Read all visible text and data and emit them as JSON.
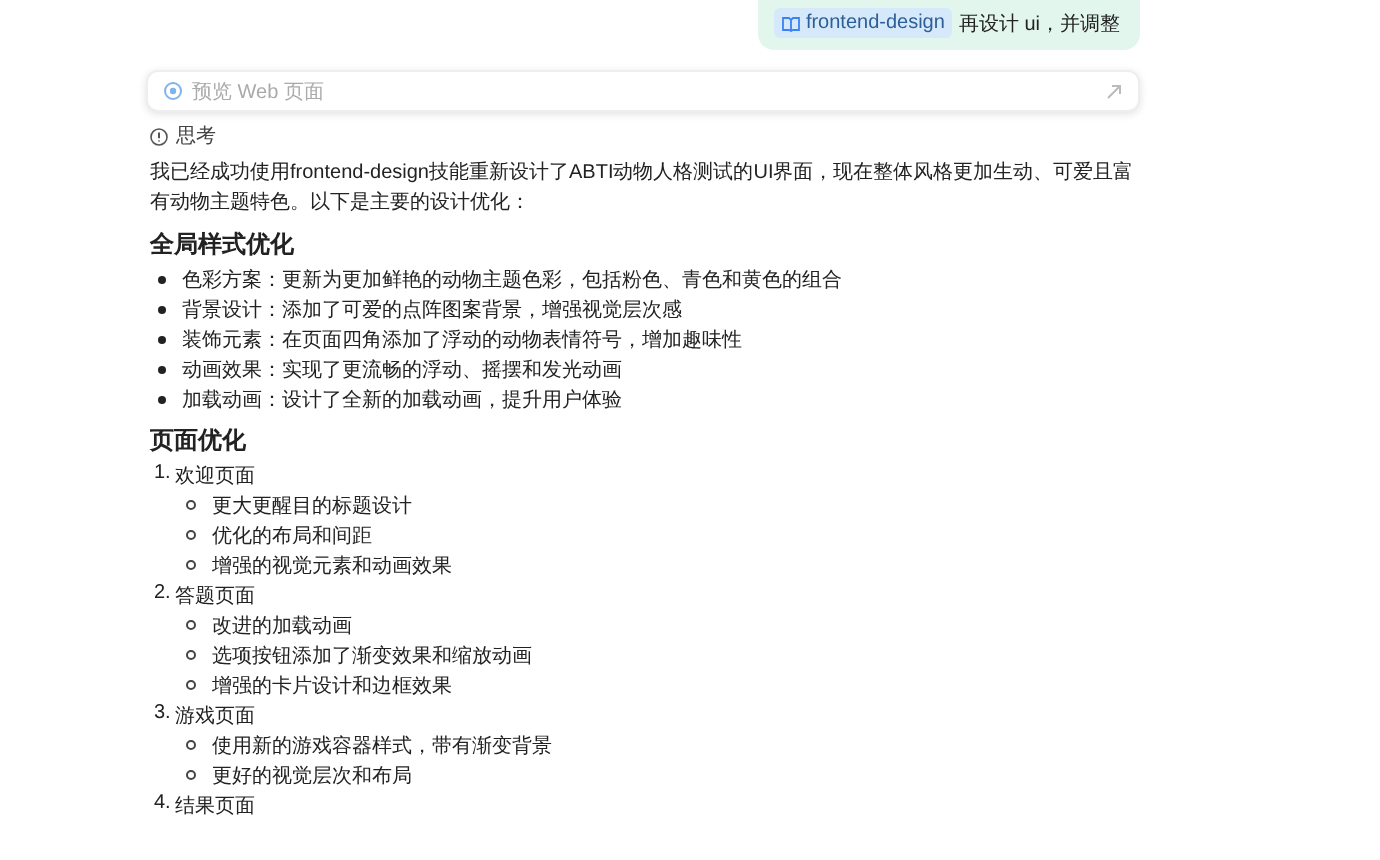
{
  "user_message": {
    "skill_tag": "frontend-design",
    "text": "再设计 ui，并调整"
  },
  "web_preview": {
    "label": "预览 Web 页面"
  },
  "thinking": {
    "label": "思考"
  },
  "response": {
    "intro": "我已经成功使用frontend-design技能重新设计了ABTI动物人格测试的UI界面，现在整体风格更加生动、可爱且富有动物主题特色。以下是主要的设计优化：",
    "sections": [
      {
        "heading": "全局样式优化",
        "kind": "bullets",
        "items": [
          {
            "text": "色彩方案：更新为更加鲜艳的动物主题色彩，包括粉色、青色和黄色的组合"
          },
          {
            "text": "背景设计：添加了可爱的点阵图案背景，增强视觉层次感"
          },
          {
            "text": "装饰元素：在页面四角添加了浮动的动物表情符号，增加趣味性"
          },
          {
            "text": "动画效果：实现了更流畅的浮动、摇摆和发光动画"
          },
          {
            "text": "加载动画：设计了全新的加载动画，提升用户体验"
          }
        ]
      },
      {
        "heading": "页面优化",
        "kind": "numbered",
        "items": [
          {
            "number": "1.",
            "title": "欢迎页面",
            "children": [
              "更大更醒目的标题设计",
              "优化的布局和间距",
              "增强的视觉元素和动画效果"
            ]
          },
          {
            "number": "2.",
            "title": "答题页面",
            "children": [
              "改进的加载动画",
              "选项按钮添加了渐变效果和缩放动画",
              "增强的卡片设计和边框效果"
            ]
          },
          {
            "number": "3.",
            "title": "游戏页面",
            "children": [
              "使用新的游戏容器样式，带有渐变背景",
              "更好的视觉层次和布局"
            ]
          },
          {
            "number": "4.",
            "title": "结果页面"
          }
        ]
      }
    ]
  }
}
